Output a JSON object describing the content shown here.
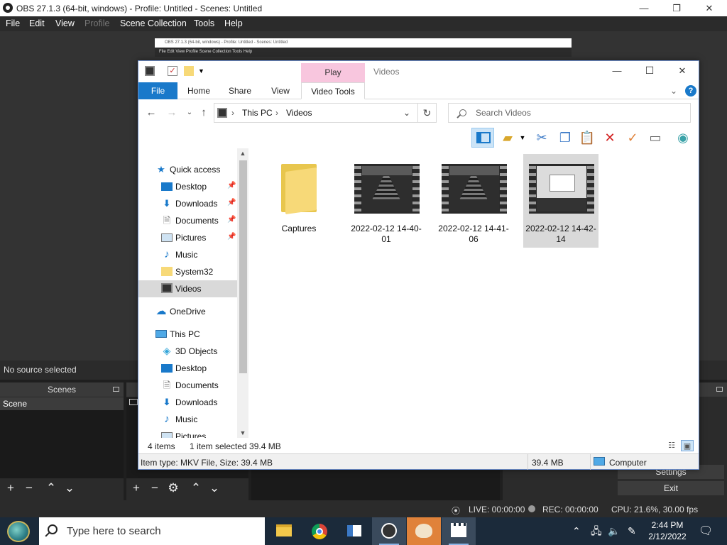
{
  "obs": {
    "window_title": "OBS 27.1.3 (64-bit, windows) - Profile: Untitled - Scenes: Untitled",
    "controls": {
      "minimize": "—",
      "maximize": "❐",
      "close": "✕"
    },
    "menu": [
      "File",
      "Edit",
      "View",
      "Profile",
      "Scene Collection",
      "Tools",
      "Help"
    ],
    "nested_title": "OBS 27.1.3 (64-bit, windows) - Profile: Untitled - Scenes: Untitled",
    "nested_menu": "File   Edit   View   Profile   Scene Collection   Tools   Help",
    "source_status": "No source selected",
    "scenes_header": "Scenes",
    "scene_item": "Scene",
    "control_buttons": [
      "Settings",
      "Exit"
    ],
    "status": {
      "live": "LIVE: 00:00:00",
      "rec": "REC: 00:00:00",
      "cpu": "CPU: 21.6%, 30.00 fps"
    }
  },
  "explorer": {
    "title": "Videos",
    "context_tab": "Play",
    "ribbon_tabs": [
      "File",
      "Home",
      "Share",
      "View",
      "Video Tools"
    ],
    "address": [
      "This PC",
      "Videos"
    ],
    "search_placeholder": "Search Videos",
    "nav": {
      "quick_access": "Quick access",
      "quick_items": [
        "Desktop",
        "Downloads",
        "Documents",
        "Pictures",
        "Music",
        "System32",
        "Videos"
      ],
      "onedrive": "OneDrive",
      "this_pc": "This PC",
      "pc_items": [
        "3D Objects",
        "Desktop",
        "Documents",
        "Downloads",
        "Music",
        "Pictures"
      ]
    },
    "files": [
      {
        "name": "Captures",
        "type": "folder"
      },
      {
        "name": "2022-02-12 14-40-01",
        "type": "video"
      },
      {
        "name": "2022-02-12 14-41-06",
        "type": "video"
      },
      {
        "name": "2022-02-12 14-42-14",
        "type": "video",
        "selected": true
      }
    ],
    "statusbar": {
      "count": "4 items",
      "selected": "1 item selected  39.4 MB"
    },
    "details": {
      "item_type": "Item type: MKV File, Size: 39.4 MB",
      "size": "39.4 MB",
      "location": "Computer"
    }
  },
  "taskbar": {
    "search_placeholder": "Type here to search",
    "time": "2:44 PM",
    "date": "2/12/2022"
  },
  "colors": {
    "accent": "#1979ca",
    "context_tab": "#f8c6de",
    "obs_bg": "#2b2b2b"
  }
}
